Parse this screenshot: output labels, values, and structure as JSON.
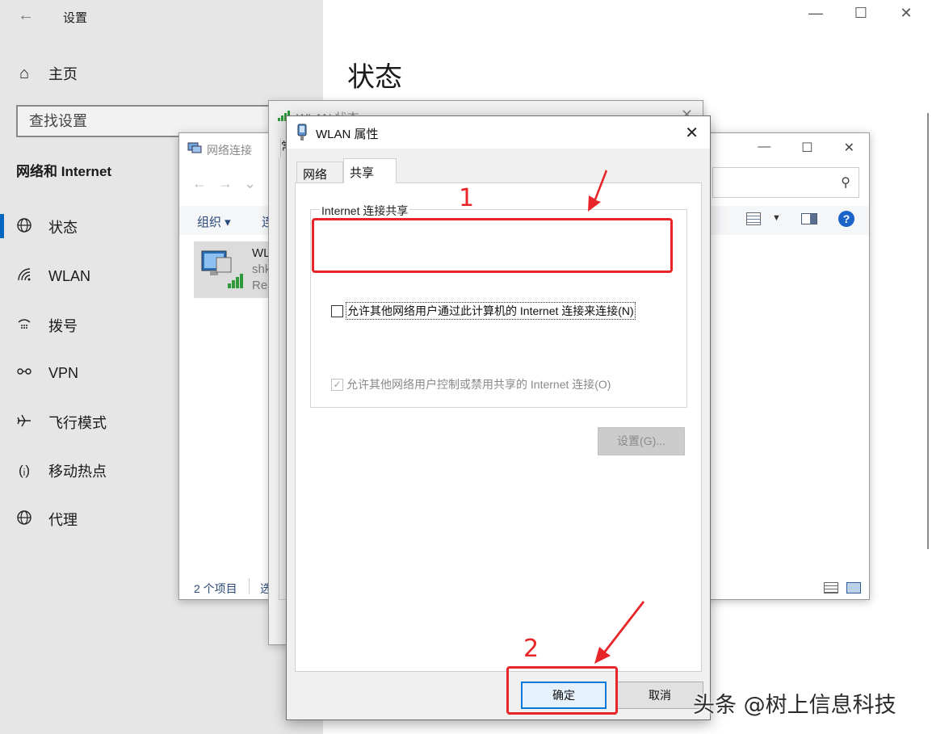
{
  "settings": {
    "title": "设置",
    "home": "主页",
    "search_placeholder": "查找设置",
    "section": "网络和 Internet",
    "nav": [
      {
        "label": "状态",
        "icon": "globe-status-icon"
      },
      {
        "label": "WLAN",
        "icon": "wifi-icon"
      },
      {
        "label": "拨号",
        "icon": "dialup-icon"
      },
      {
        "label": "VPN",
        "icon": "vpn-icon"
      },
      {
        "label": "飞行模式",
        "icon": "airplane-icon"
      },
      {
        "label": "移动热点",
        "icon": "hotspot-icon"
      },
      {
        "label": "代理",
        "icon": "globe-proxy-icon"
      }
    ],
    "heading": "状态"
  },
  "netconn": {
    "title": "网络连接",
    "organize": "组织 ▾",
    "cmd2": "连",
    "item": {
      "name": "WL",
      "sub1": "shk",
      "sub2": "Rea"
    },
    "status_count": "2 个项目",
    "status_sel": "选"
  },
  "wlan_status": {
    "title": "WLAN 状态",
    "tab_stub": "常"
  },
  "props": {
    "title": "WLAN 属性",
    "tabs": [
      "网络",
      "共享"
    ],
    "group_title": "Internet 连接共享",
    "check1": "允许其他网络用户通过此计算机的 Internet 连接来连接(N)",
    "check1_checked": false,
    "check2": "允许其他网络用户控制或禁用共享的 Internet 连接(O)",
    "check2_checked": true,
    "settings_button": "设置(G)...",
    "ok": "确定",
    "cancel": "取消"
  },
  "annotations": {
    "num1": "1",
    "num2": "2",
    "color": "#e8262a"
  },
  "watermark": "头条 @树上信息科技"
}
